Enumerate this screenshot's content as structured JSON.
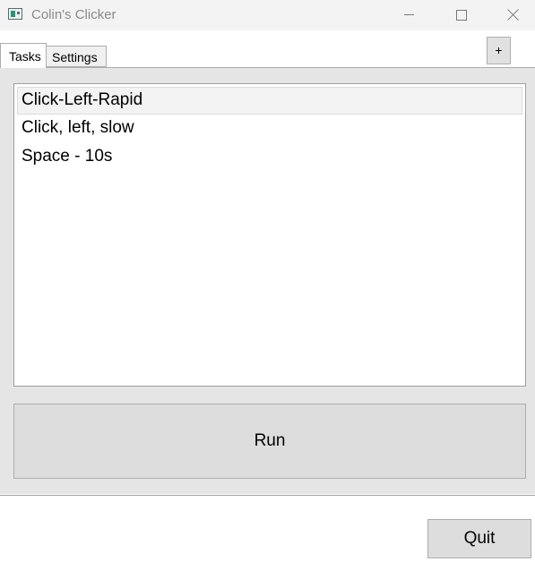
{
  "window": {
    "title": "Colin's Clicker",
    "icon": "app-window-icon",
    "controls": {
      "minimize_icon": "minimize-icon",
      "maximize_icon": "maximize-icon",
      "close_icon": "close-icon"
    }
  },
  "tabs": [
    {
      "label": "Tasks",
      "selected": true
    },
    {
      "label": "Settings",
      "selected": false
    }
  ],
  "add_button": {
    "label": "+"
  },
  "task_list": {
    "items": [
      {
        "label": "Click-Left-Rapid",
        "selected": true
      },
      {
        "label": "Click, left, slow",
        "selected": false
      },
      {
        "label": "Space - 10s",
        "selected": false
      }
    ]
  },
  "run_button": {
    "label": "Run"
  },
  "quit_button": {
    "label": "Quit"
  },
  "colors": {
    "titlebar_bg": "#f3f3f3",
    "panel_bg": "#e5e5e5",
    "button_bg": "#dddddd",
    "border": "#adadad"
  }
}
